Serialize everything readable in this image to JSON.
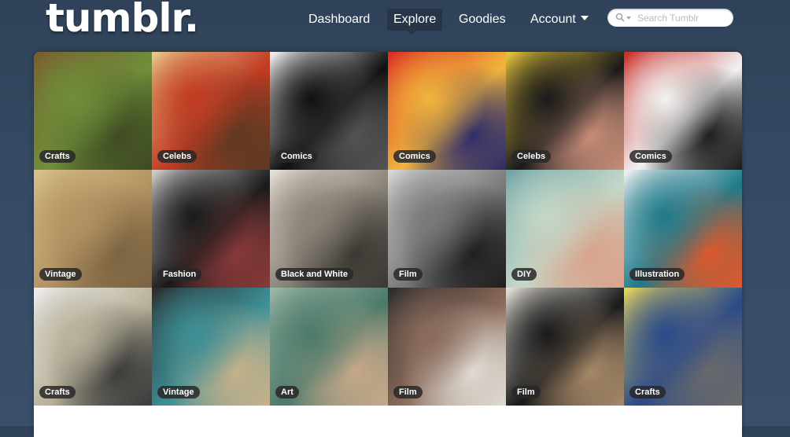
{
  "header": {
    "logo": "tumblr.",
    "nav": [
      {
        "label": "Dashboard",
        "active": false
      },
      {
        "label": "Explore",
        "active": true
      },
      {
        "label": "Goodies",
        "active": false
      },
      {
        "label": "Account",
        "active": false,
        "dropdown": true
      }
    ],
    "search": {
      "placeholder": "Search Tumblr",
      "value": ""
    }
  },
  "grid": {
    "tiles": [
      {
        "label": "Crafts",
        "image": "green-beaded-craft",
        "colors": [
          "#7a5a2e",
          "#6f8f3a",
          "#3e4a22"
        ]
      },
      {
        "label": "Celebs",
        "image": "man-red-shirt-on-horse",
        "colors": [
          "#e9c98a",
          "#c23a22",
          "#5a3a22"
        ]
      },
      {
        "label": "Comics",
        "image": "black-white-comic-figure",
        "colors": [
          "#f4f4f4",
          "#111111",
          "#555555"
        ]
      },
      {
        "label": "Comics",
        "image": "batwoman-comic-cover",
        "colors": [
          "#d92a22",
          "#f1b53c",
          "#2b2b6a"
        ]
      },
      {
        "label": "Celebs",
        "image": "woman-black-bob-hair",
        "colors": [
          "#e8c63a",
          "#1a1a1a",
          "#c98f7a"
        ]
      },
      {
        "label": "Comics",
        "image": "red-stylized-comic",
        "colors": [
          "#c92a22",
          "#f2f2f2",
          "#1a1a1a"
        ]
      },
      {
        "label": "Vintage",
        "image": "sepia-photo-microscope",
        "colors": [
          "#d9c38f",
          "#b39362",
          "#7a6341"
        ]
      },
      {
        "label": "Fashion",
        "image": "checkered-fur-coat",
        "colors": [
          "#cfcfcf",
          "#1a1a1a",
          "#8a3a3a"
        ]
      },
      {
        "label": "Black and White",
        "image": "woman-wire-headdress",
        "colors": [
          "#e6e1d8",
          "#8a8378",
          "#3a3732"
        ]
      },
      {
        "label": "Film",
        "image": "man-sunglasses-bw",
        "colors": [
          "#d8d8d8",
          "#7a7a7a",
          "#1e1e1e"
        ]
      },
      {
        "label": "DIY",
        "image": "painted-bangle",
        "colors": [
          "#6fa2a6",
          "#c4d8c8",
          "#d9a28a"
        ]
      },
      {
        "label": "Illustration",
        "image": "bird-illustration",
        "colors": [
          "#f2f2f2",
          "#1e7a8a",
          "#e0582a"
        ]
      },
      {
        "label": "Crafts",
        "image": "paper-collage-box",
        "colors": [
          "#efefef",
          "#b9b29a",
          "#3a3a3a"
        ]
      },
      {
        "label": "Vintage",
        "image": "twin-girls-teal-dresses",
        "colors": [
          "#2a2a2a",
          "#3c8f96",
          "#c9b28a"
        ]
      },
      {
        "label": "Art",
        "image": "hands-sea-painting",
        "colors": [
          "#9fb7a8",
          "#4d7a6a",
          "#c9a98a"
        ]
      },
      {
        "label": "Film",
        "image": "two-men-film-still",
        "colors": [
          "#2a2a2a",
          "#8a6a5a",
          "#e0dcd4"
        ]
      },
      {
        "label": "Film",
        "image": "men-in-tuxedos",
        "colors": [
          "#e8e4dc",
          "#1a1a1a",
          "#a88a6a"
        ]
      },
      {
        "label": "Crafts",
        "image": "tin-can-utensil-holders",
        "colors": [
          "#e8d65a",
          "#2a4a8a",
          "#6a6a6a"
        ]
      }
    ]
  }
}
